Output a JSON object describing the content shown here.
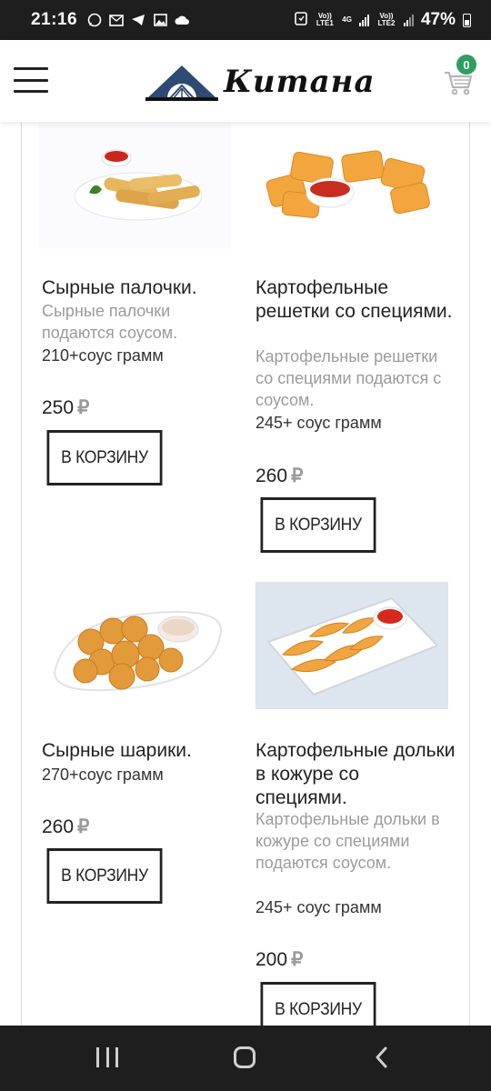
{
  "status_bar": {
    "time": "21:16",
    "net1": "Vo)) LTE1",
    "net2": "4G",
    "net3": "Vo)) LTE2",
    "battery": "47%"
  },
  "header": {
    "logo_text": "Китана",
    "cart_count": "0"
  },
  "products": [
    {
      "title": "Сырные палочки.",
      "description": "Сырные палочки подаются соусом.",
      "weight": "210+соус грамм",
      "price": "250",
      "currency": "₽",
      "button": "В КОРЗИНУ",
      "image": "cheese-sticks-image"
    },
    {
      "title": "Картофельные решетки со специями.",
      "description": "Картофельные решетки со специями подаются с соусом.",
      "weight": "245+ соус грамм",
      "price": "260",
      "currency": "₽",
      "button": "В КОРЗИНУ",
      "image": "waffle-fries-image"
    },
    {
      "title": "Сырные шарики.",
      "description": "",
      "weight": "270+соус грамм",
      "price": "260",
      "currency": "₽",
      "button": "В КОРЗИНУ",
      "image": "cheese-balls-image"
    },
    {
      "title": "Картофельные дольки в кожуре со специями.",
      "description": "Картофельные дольки в кожуре со специями подаются соусом.",
      "weight": "245+ соус грамм",
      "price": "200",
      "currency": "₽",
      "button": "В КОРЗИНУ",
      "image": "potato-wedges-image"
    }
  ],
  "colors": {
    "badge": "#2f9e61",
    "system_bar": "#1e1e1e",
    "muted_text": "#9b9b9b"
  }
}
